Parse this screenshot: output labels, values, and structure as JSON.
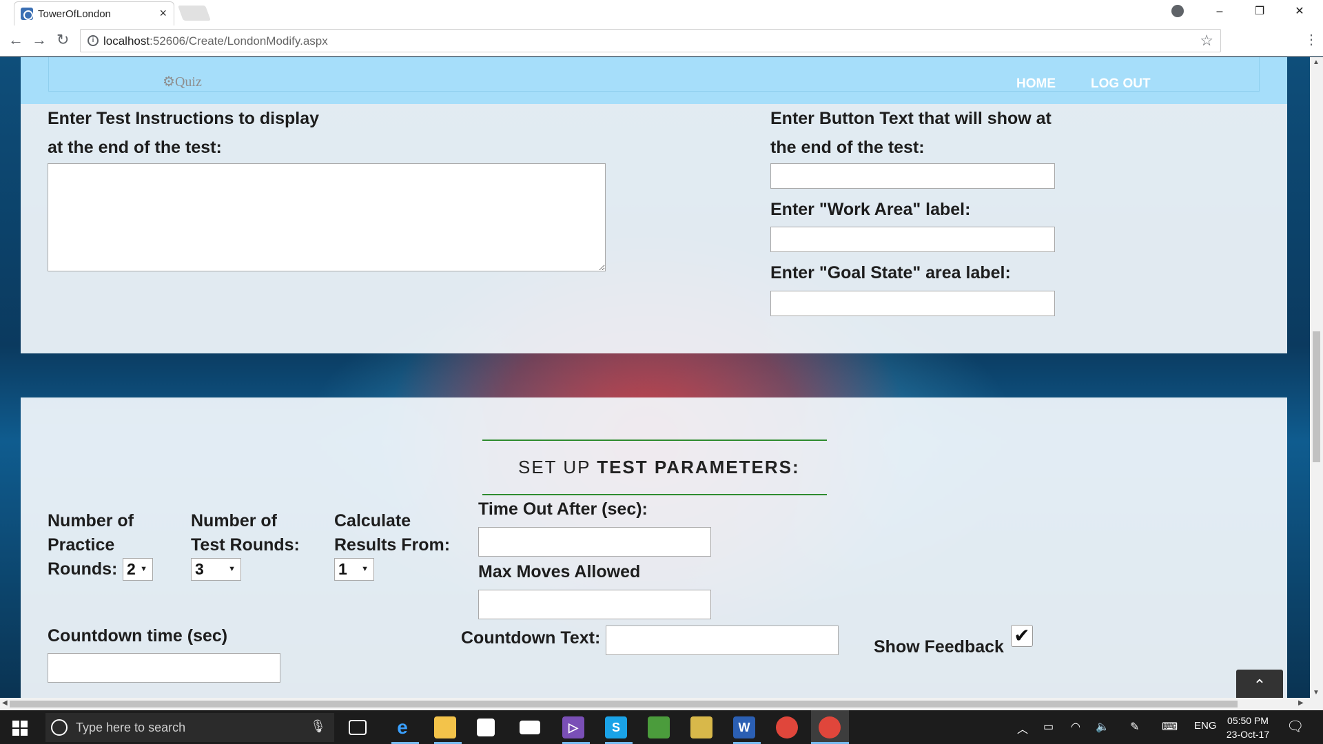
{
  "browser": {
    "tab_title": "TowerOfLondon",
    "tab_close": "×",
    "url_host": "localhost",
    "url_path": ":52606/Create/LondonModify.aspx",
    "window": {
      "minimize": "–",
      "restore": "❐",
      "close": "✕"
    }
  },
  "nav": {
    "brand": "Quiz",
    "home": "HOME",
    "logout": "LOG OUT"
  },
  "top_panel": {
    "end_instructions_label_line1": "Enter Test Instructions to display",
    "end_instructions_label_line2": "at the end of the test:",
    "end_instructions_value": "",
    "button_text_label_line1": "Enter Button Text that will show at",
    "button_text_label_line2": "the end of the test:",
    "button_text_value": "",
    "work_area_label": "Enter \"Work Area\" label:",
    "work_area_value": "",
    "goal_state_label": "Enter \"Goal State\" area label:",
    "goal_state_value": ""
  },
  "params": {
    "title_prefix": "SET UP ",
    "title_bold": "TEST PARAMETERS:",
    "practice_rounds": {
      "line1": "Number of",
      "line2": "Practice",
      "line3": "Rounds:",
      "value": "2"
    },
    "test_rounds": {
      "line1": "Number of",
      "line2": "Test Rounds:",
      "value": "3"
    },
    "calc_results": {
      "line1": "Calculate",
      "line2": "Results From:",
      "value": "1"
    },
    "timeout_label": "Time Out After (sec):",
    "timeout_value": "",
    "max_moves_label": "Max Moves Allowed",
    "max_moves_value": "",
    "countdown_time_label": "Countdown time (sec)",
    "countdown_time_value": "",
    "countdown_text_label": "Countdown Text:",
    "countdown_text_value": "",
    "show_feedback_label": "Show Feedback",
    "show_feedback_checked": true
  },
  "scroll_top_icon": "chevron-up",
  "taskbar": {
    "search_placeholder": "Type here to search",
    "language": "ENG",
    "time": "05:50 PM",
    "date": "23-Oct-17"
  }
}
